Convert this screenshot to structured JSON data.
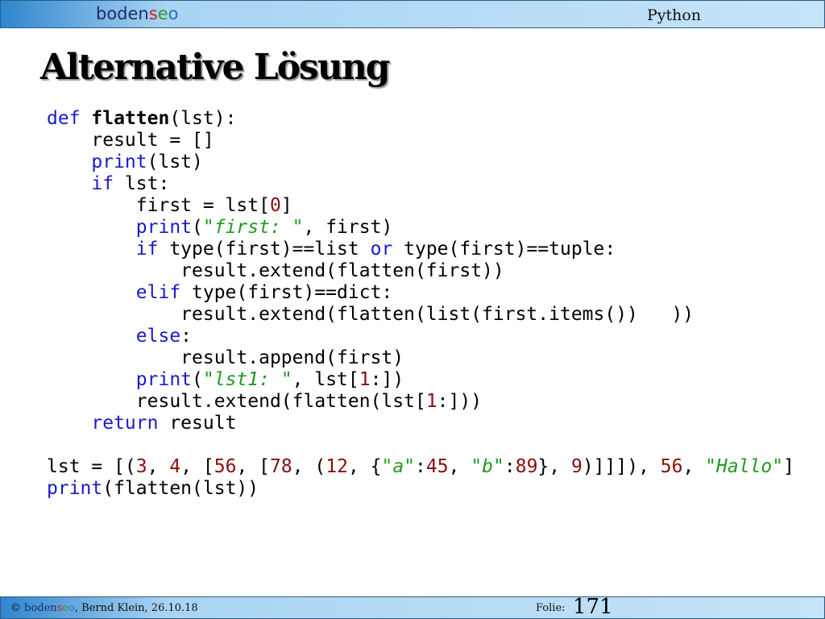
{
  "header": {
    "logo": {
      "part1": "boden",
      "part2": "s",
      "part3": "e",
      "part4": "o"
    },
    "course": "Python"
  },
  "slide": {
    "title": "Alternative Lösung"
  },
  "code": {
    "t_def": "def",
    "t_flatten": "flatten",
    "t_print": "print",
    "t_if": "if",
    "t_or": "or",
    "t_elif": "elif",
    "t_else": "else",
    "t_return": "return",
    "t_zero": "0",
    "t_one": "1",
    "t_first_str": "\"first: \"",
    "t_lst1_str": "\"lst1: \"",
    "n3": "3",
    "n4": "4",
    "n56": "56",
    "n78": "78",
    "n12": "12",
    "n45": "45",
    "n89": "89",
    "n9": "9",
    "s_a": "\"a\"",
    "s_b": "\"b\"",
    "s_hallo": "\"Hallo\""
  },
  "footer": {
    "copyright_symbol": "©",
    "logo": {
      "part1": "boden",
      "part2": "s",
      "part3": "e",
      "part4": "o"
    },
    "author_date": ", Bernd Klein, 26.10.18",
    "folie_label": "Folie:",
    "page_number": "171"
  }
}
